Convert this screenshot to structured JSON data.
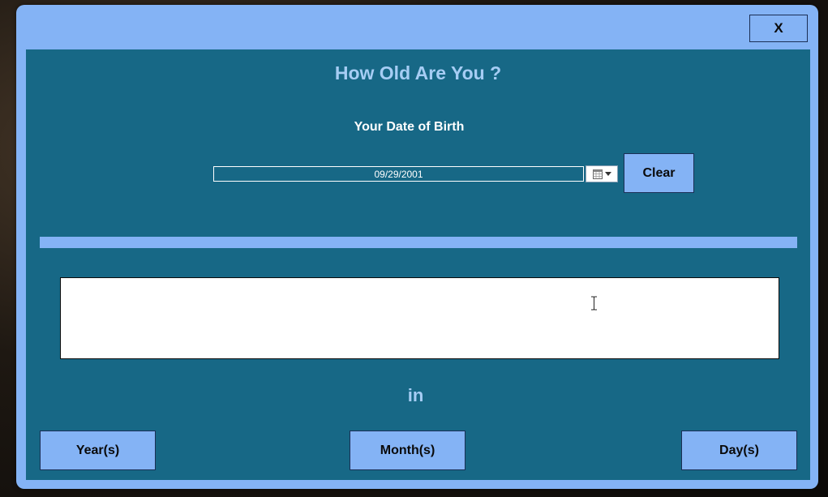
{
  "window": {
    "close_label": "X"
  },
  "main": {
    "title": "How Old Are You ?",
    "dob_label": "Your Date of Birth",
    "dob_value": "09/29/2001",
    "clear_label": "Clear",
    "result_text": "",
    "in_label": "in"
  },
  "units": {
    "years_label": "Year(s)",
    "months_label": "Month(s)",
    "days_label": "Day(s)"
  },
  "icons": {
    "calendar": "calendar-icon",
    "dropdown": "chevron-down-icon",
    "cursor": "text-cursor-icon"
  },
  "colors": {
    "window_frame": "#84b3f5",
    "panel_bg": "#176886",
    "title_text": "#a6cdf4",
    "button_bg": "#84b3f5"
  }
}
